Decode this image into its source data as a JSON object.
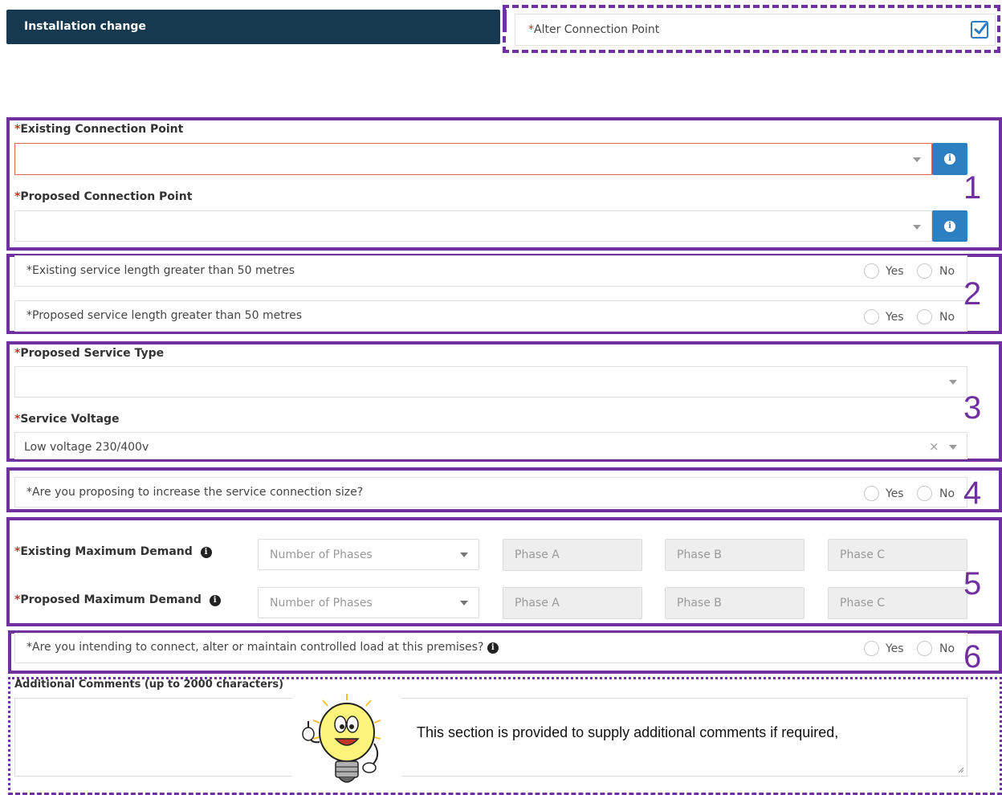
{
  "header": {
    "title": "Installation change"
  },
  "alter": {
    "required_mark": "*",
    "label": "Alter Connection Point",
    "checked": true
  },
  "section1": {
    "number": "1",
    "existing_label": "Existing Connection Point",
    "proposed_label": "Proposed Connection Point",
    "required_mark": "*"
  },
  "section2": {
    "number": "2",
    "q1": "*Existing service length greater than 50 metres",
    "q2": "*Proposed service length greater than 50 metres",
    "yes": "Yes",
    "no": "No"
  },
  "section3": {
    "number": "3",
    "service_type_label": "Proposed Service Type",
    "voltage_label": "Service Voltage",
    "voltage_value": "Low voltage 230/400v",
    "clear_symbol": "×",
    "required_mark": "*"
  },
  "section4": {
    "number": "4",
    "q": "*Are you proposing to increase the service connection size?",
    "yes": "Yes",
    "no": "No"
  },
  "section5": {
    "number": "5",
    "existing_label": "Existing Maximum Demand",
    "proposed_label": "Proposed Maximum Demand",
    "phases_placeholder": "Number of Phases",
    "phase_a": "Phase A",
    "phase_b": "Phase B",
    "phase_c": "Phase C",
    "required_mark": "*"
  },
  "section6": {
    "number": "6",
    "q": "*Are you intending to connect, alter or maintain controlled load at this premises?",
    "yes": "Yes",
    "no": "No"
  },
  "comments": {
    "label": "Additional Comments (up to 2000 characters)",
    "tip": "This section is provided to supply additional comments if required,"
  },
  "colors": {
    "accent": "#7030a0",
    "header_bg": "#17394f",
    "info_button": "#2c7fc1",
    "required": "#c0392b"
  },
  "icons": [
    "check-icon",
    "info-icon",
    "chevron-down-icon",
    "clear-icon",
    "lightbulb-mascot-icon"
  ]
}
